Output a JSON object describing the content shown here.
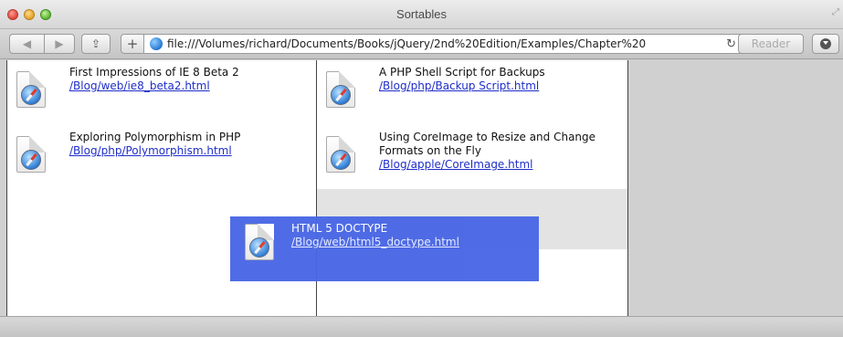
{
  "window": {
    "title": "Sortables"
  },
  "toolbar": {
    "back_label": "◀",
    "forward_label": "▶",
    "share_label": "⇪",
    "plus_label": "+",
    "url": "file:///Volumes/richard/Documents/Books/jQuery/2nd%20Edition/Examples/Chapter%20",
    "reload_label": "↻",
    "reader_label": "Reader"
  },
  "lists": {
    "left": [
      {
        "title": "First Impressions of IE 8 Beta 2",
        "link": "/Blog/web/ie8_beta2.html"
      },
      {
        "title": "Exploring Polymorphism in PHP",
        "link": "/Blog/php/Polymorphism.html"
      }
    ],
    "right": [
      {
        "title": "A PHP Shell Script for Backups",
        "link": "/Blog/php/Backup Script.html"
      },
      {
        "title": "Using CoreImage to Resize and Change Formats on the Fly",
        "link": "/Blog/apple/CoreImage.html"
      }
    ]
  },
  "dragging": {
    "title": "HTML 5 DOCTYPE",
    "link": "/Blog/web/html5_doctype.html"
  },
  "colors": {
    "helper": "#4a68e6",
    "link": "#1f2ec8",
    "placeholder": "#e3e3e3"
  }
}
